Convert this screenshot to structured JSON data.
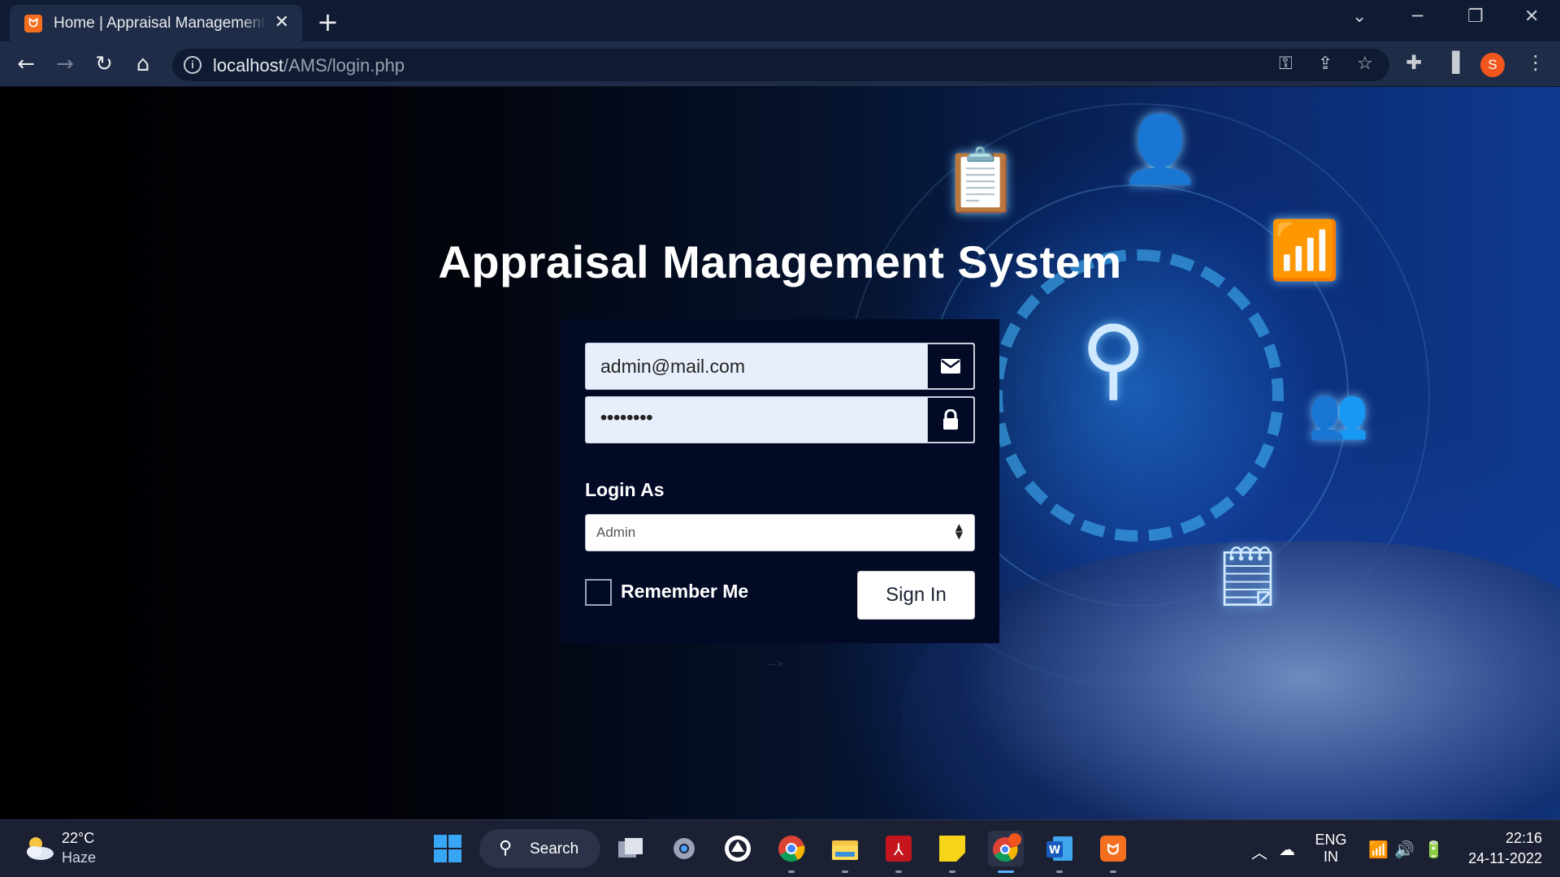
{
  "browser": {
    "tab_title": "Home | Appraisal Management System",
    "tab_close": "✕",
    "new_tab": "+",
    "url_host": "localhost",
    "url_path": "/AMS/login.php",
    "profile_initial": "S",
    "icons": [
      "back-icon",
      "forward-icon",
      "reload-icon",
      "home-icon",
      "info-icon",
      "key-icon",
      "share-icon",
      "star-icon",
      "extensions-icon",
      "side-panel-icon",
      "menu-icon"
    ]
  },
  "page": {
    "title": "Appraisal Management System",
    "email_value": "admin@mail.com",
    "password_value": "••••••••",
    "login_as_label": "Login As",
    "login_as_selected": "Admin",
    "remember_label": "Remember Me",
    "signin_label": "Sign In",
    "stray_text": "-->"
  },
  "taskbar": {
    "weather_temp": "22°C",
    "weather_cond": "Haze",
    "search_label": "Search",
    "lang_top": "ENG",
    "lang_bottom": "IN",
    "time": "22:16",
    "date": "24-11-2022",
    "chrome_badge": "S",
    "apps": [
      "task-view",
      "settings",
      "github-desktop",
      "chrome",
      "file-explorer",
      "acrobat",
      "sticky-notes",
      "chrome-active",
      "word",
      "xampp"
    ]
  },
  "colors": {
    "chrome_bg": "#0f1b33",
    "toolbar_bg": "#1f2c48",
    "card_bg": "#020a26",
    "taskbar_bg": "#1b2133",
    "accent": "#38a5f5"
  }
}
